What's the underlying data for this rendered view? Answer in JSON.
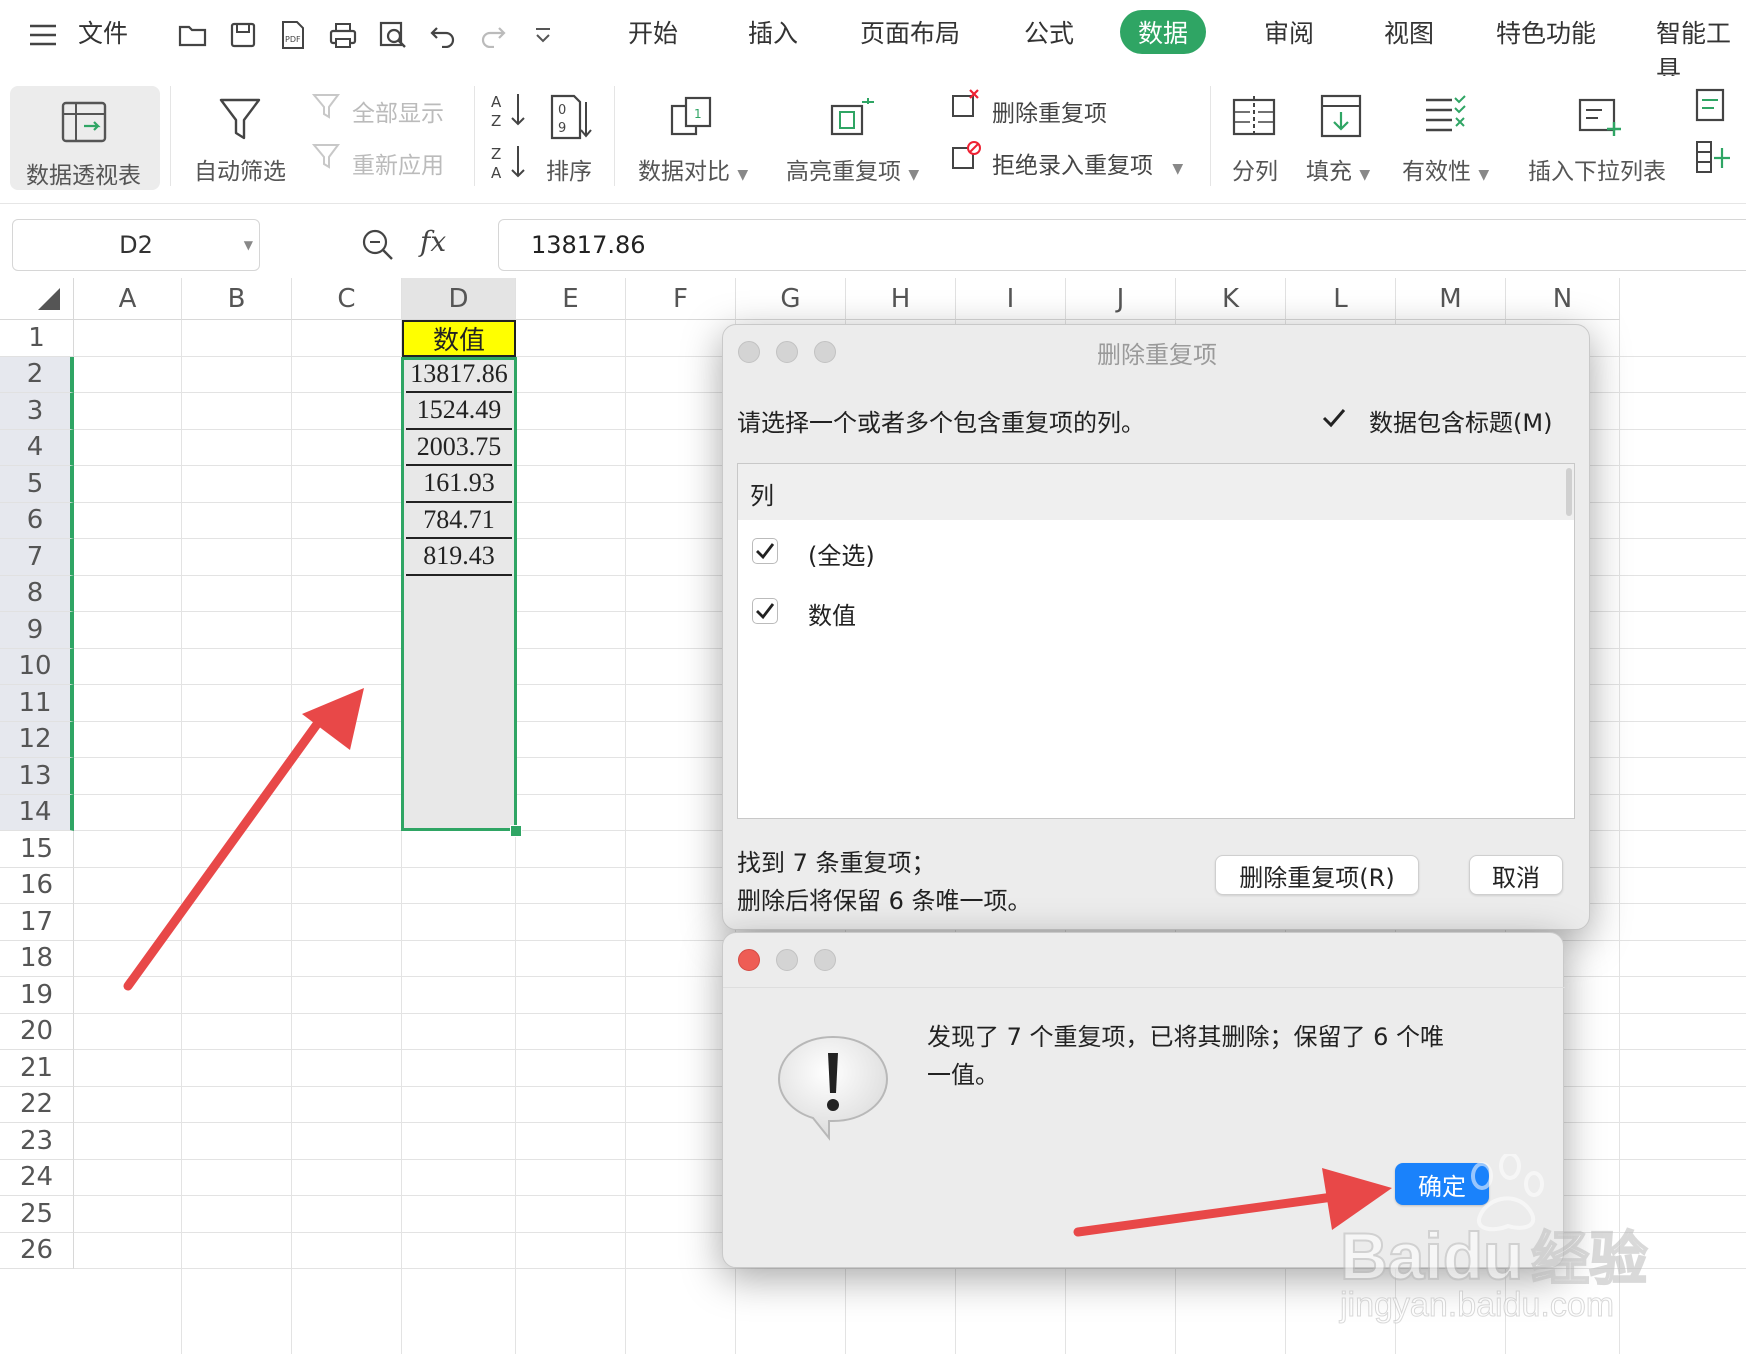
{
  "menu": {
    "items": [
      "文件",
      "开始",
      "插入",
      "页面布局",
      "公式",
      "数据",
      "审阅",
      "视图",
      "特色功能",
      "智能工具"
    ],
    "active": "数据",
    "accent": "#2fa564"
  },
  "ribbon": {
    "pivot": "数据透视表",
    "autofilter": "自动筛选",
    "show_all": "全部显示",
    "reapply": "重新应用",
    "sort": "排序",
    "compare": "数据对比",
    "highlight_dup": "高亮重复项",
    "remove_dup": "删除重复项",
    "reject_dup": "拒绝录入重复项",
    "split": "分列",
    "fill": "填充",
    "validity": "有效性",
    "insert_dropdown": "插入下拉列表"
  },
  "formula_bar": {
    "cell_ref": "D2",
    "fx": "fx",
    "value": "13817.86"
  },
  "sheet": {
    "columns": [
      "A",
      "B",
      "C",
      "D",
      "E",
      "F",
      "G",
      "H",
      "I",
      "J",
      "K",
      "L",
      "M",
      "N"
    ],
    "rows": [
      "1",
      "2",
      "3",
      "4",
      "5",
      "6",
      "7",
      "8",
      "9",
      "10",
      "11",
      "12",
      "13",
      "14",
      "15",
      "16",
      "17",
      "18",
      "19",
      "20",
      "21",
      "22",
      "23",
      "24",
      "25",
      "26"
    ],
    "header_cell": "数值",
    "values": [
      "13817.86",
      "1524.49",
      "2003.75",
      "161.93",
      "784.71",
      "819.43"
    ],
    "header_color": "#ffff00",
    "selection_color": "#2fa564"
  },
  "remove_dialog": {
    "title": "删除重复项",
    "prompt": "请选择一个或者多个包含重复项的列。",
    "has_header_label": "数据包含标题(M)",
    "has_header_checked": true,
    "list_header": "列",
    "items": [
      {
        "label": "(全选)",
        "checked": true
      },
      {
        "label": "数值",
        "checked": true
      }
    ],
    "status_line1": "找到 7 条重复项；",
    "status_line2": "删除后将保留 6 条唯一项。",
    "remove_button": "删除重复项(R)",
    "cancel_button": "取消"
  },
  "alert": {
    "message_line1": "发现了 7 个重复项，已将其删除；保留了 6 个唯",
    "message_line2": "一值。",
    "ok_button": "确定",
    "ok_color": "#1a82fb"
  },
  "watermark": {
    "brand": "Bai",
    "brand2": "du",
    "cn": "经验",
    "url": "jingyan.baidu.com"
  }
}
